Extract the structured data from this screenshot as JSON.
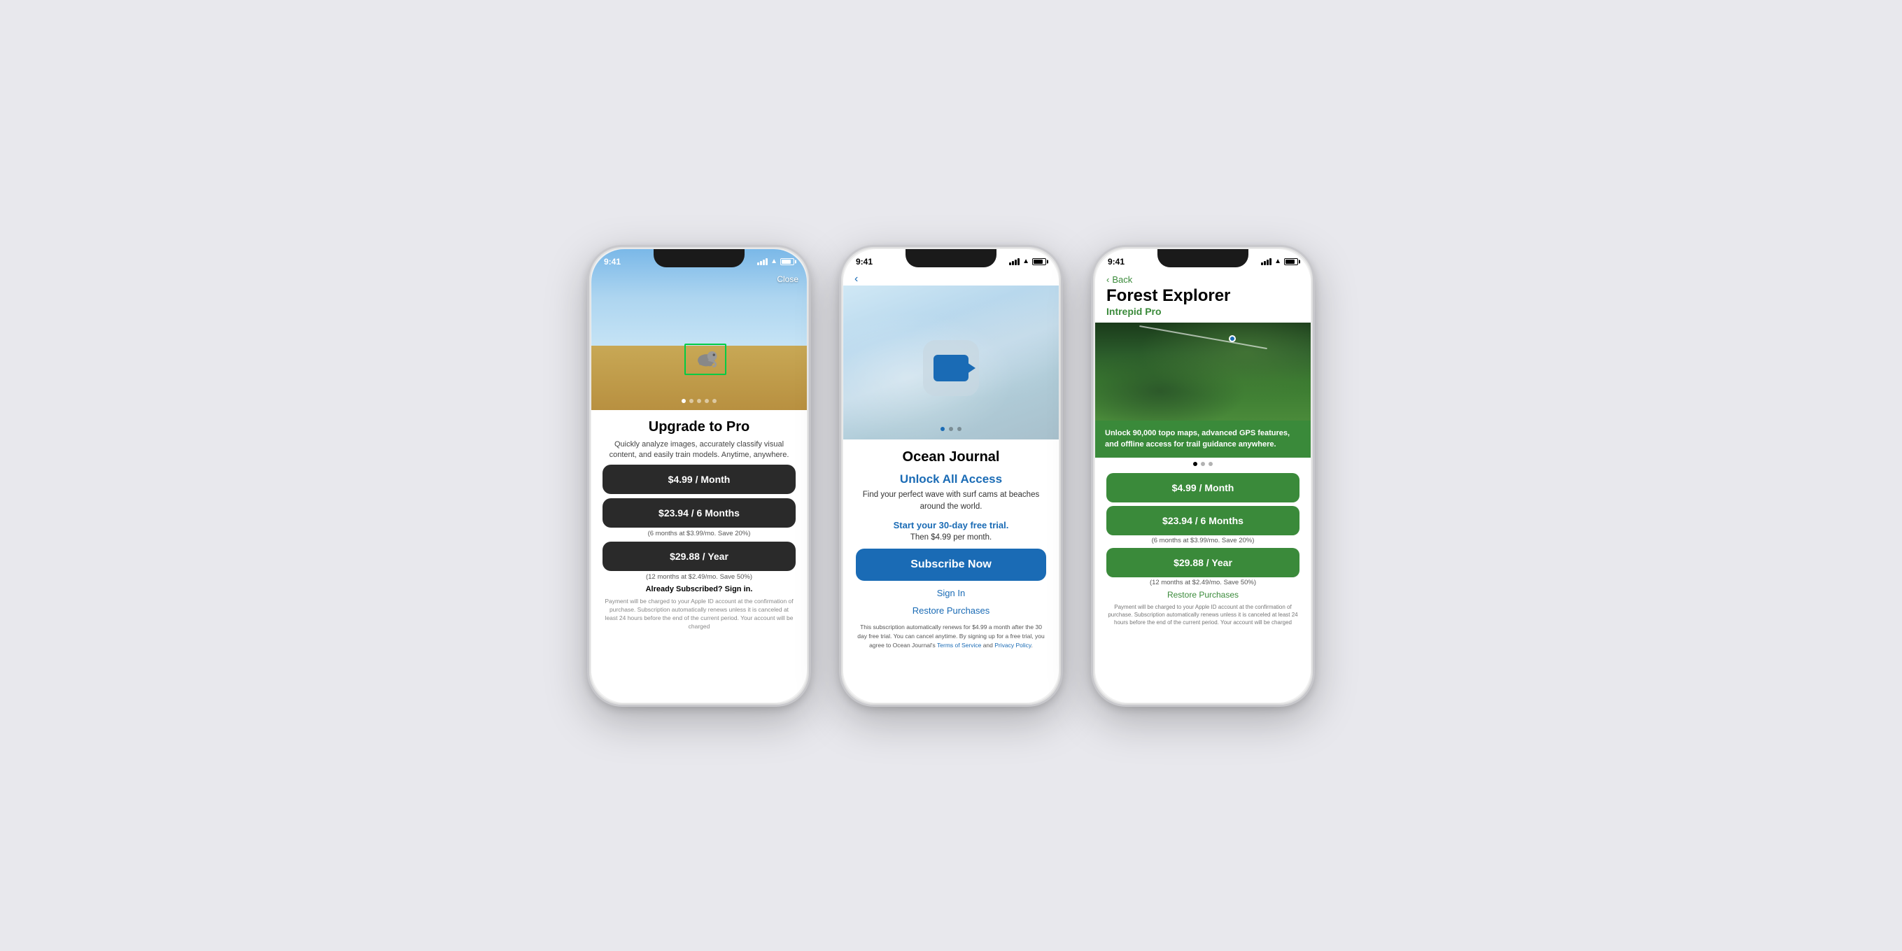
{
  "phone1": {
    "status_time": "9:41",
    "close_label": "Close",
    "title": "Upgrade to Pro",
    "subtitle": "Quickly analyze images, accurately classify visual content, and easily train models. Anytime, anywhere.",
    "plan1_label": "$4.99 / Month",
    "plan2_label": "$23.94 / 6 Months",
    "plan2_sub": "(6 months at $3.99/mo. Save 20%)",
    "plan3_label": "$29.88 / Year",
    "plan3_sub": "(12 months at $2.49/mo. Save 50%)",
    "already_subscribed": "Already Subscribed? Sign in.",
    "legal": "Payment will be charged to your Apple ID account at the confirmation of purchase. Subscription automatically renews unless it is canceled at least 24 hours before the end of the current period. Your account will be charged"
  },
  "phone2": {
    "status_time": "9:41",
    "back_label": "‹",
    "title": "Ocean Journal",
    "unlock_header": "Unlock All Access",
    "description": "Find your perfect wave with surf cams at beaches around the world.",
    "trial_text": "Start your 30-day free trial.",
    "trial_sub": "Then $4.99 per month.",
    "subscribe_label": "Subscribe Now",
    "sign_in": "Sign In",
    "restore": "Restore Purchases",
    "legal": "This subscription automatically renews for $4.99 a month after the 30 day free trial. You can cancel anytime. By signing up for a free trial, you agree to Ocean Journal's",
    "terms": "Terms of Service",
    "and": "and",
    "privacy": "Privacy Policy",
    "legal_end": "."
  },
  "phone3": {
    "status_time": "9:41",
    "back_label": "Back",
    "title": "Forest Explorer",
    "subtitle": "Intrepid Pro",
    "feature_text": "Unlock 90,000 topo maps, advanced GPS features, and offline access for trail guidance anywhere.",
    "plan1_label": "$4.99 / Month",
    "plan2_label": "$23.94 / 6 Months",
    "plan2_sub": "(6 months at $3.99/mo. Save 20%)",
    "plan3_label": "$29.88 / Year",
    "plan3_sub": "(12 months at $2.49/mo. Save 50%)",
    "restore": "Restore Purchases",
    "legal": "Payment will be charged to your Apple ID account at the confirmation of purchase. Subscription automatically renews unless it is canceled at least 24 hours before the end of the current period. Your account will be charged"
  }
}
